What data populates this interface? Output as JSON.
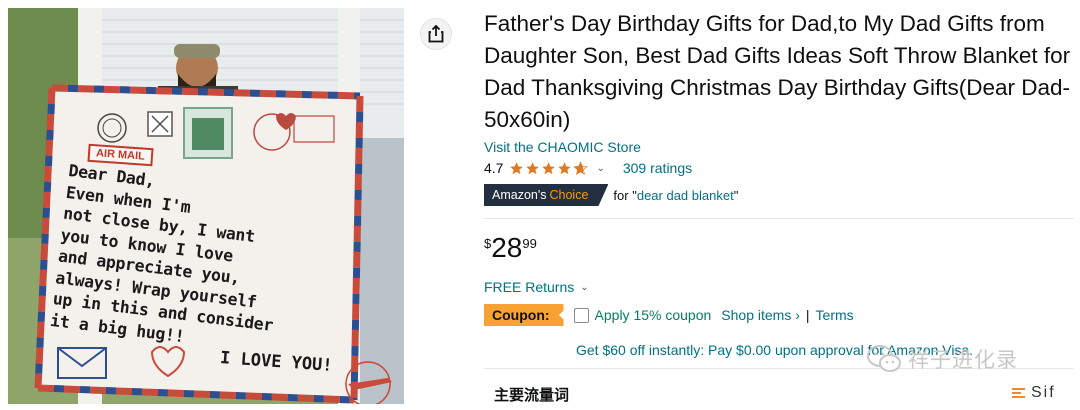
{
  "product": {
    "title": "Father's Day Birthday Gifts for Dad,to My Dad Gifts from Daughter Son, Best Dad Gifts Ideas Soft Throw Blanket for Dad Thanksgiving Christmas Day Birthday Gifts(Dear Dad-50x60in)",
    "store_link": "Visit the CHAOMIC Store",
    "rating_value": "4.7",
    "rating_stars": 4.7,
    "ratings_count": "309 ratings",
    "badge": {
      "prefix": "Amazon's",
      "suffix": "Choice",
      "for_label": "for",
      "keyword": "dear dad blanket"
    },
    "price": {
      "symbol": "$",
      "whole": "28",
      "fraction": "99"
    },
    "returns": "FREE Returns",
    "coupon": {
      "badge": "Coupon:",
      "apply_text": "Apply 15% coupon",
      "shop_items": "Shop items ›",
      "separator": "|",
      "terms": "Terms"
    },
    "visa_offer": "Get $60 off instantly: Pay $0.00 upon approval for Amazon Visa."
  },
  "image": {
    "stamp_text": "AIR MAIL",
    "blanket_lines": [
      "Dear Dad,",
      "  Even when I'm",
      " not close by, I want",
      "you to know I love",
      "and appreciate you,",
      "always! Wrap yourself",
      "up in this and consider",
      "it a big hug!!"
    ],
    "love_you": "I LOVE YOU!"
  },
  "section_heading": "主要流量词",
  "watermark": "祥子进化录",
  "brand_logo": "Sif",
  "colors": {
    "link": "#007185",
    "badge_dark": "#232f3e",
    "badge_orange": "#ff9900",
    "coupon_orange": "#f7a233",
    "coupon_green": "#067d62",
    "star": "#de7921"
  },
  "icons": {
    "share": "share-icon",
    "star": "star-icon",
    "chevron": "chevron-down-icon",
    "checkbox": "checkbox-icon",
    "wechat": "wechat-icon"
  }
}
